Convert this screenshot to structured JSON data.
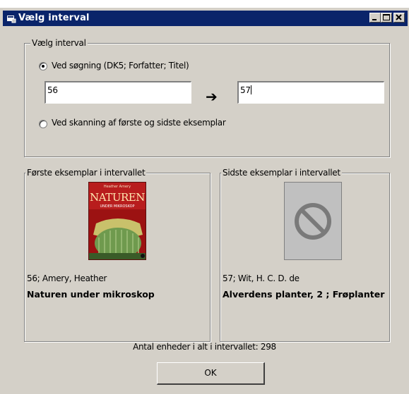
{
  "window": {
    "title": "Vælg interval"
  },
  "interval_group": {
    "legend": "Vælg interval",
    "option_search": {
      "label": "Ved søgning (DK5; Forfatter; Titel)",
      "selected": true
    },
    "from_value": "56",
    "to_value": "57",
    "arrow": "➔",
    "option_scan": {
      "label": "Ved skanning af første og sidste eksemplar",
      "selected": false
    }
  },
  "first_copy": {
    "legend": "Første eksemplar i intervallet",
    "cover": {
      "top_text": "Heather Amery",
      "title_text": "NATUREN",
      "subtitle_text": "UNDER MIKROSKOP"
    },
    "id_author": "56; Amery, Heather",
    "title": "Naturen under mikroskop"
  },
  "last_copy": {
    "legend": "Sidste eksemplar i intervallet",
    "cover_icon": "no-image-icon",
    "id_author": "57; Wit, H. C. D. de",
    "title": "Alverdens planter, 2 ; Frøplanter"
  },
  "total_text": "Antal enheder i alt i intervallet: 298",
  "ok_label": "OK"
}
